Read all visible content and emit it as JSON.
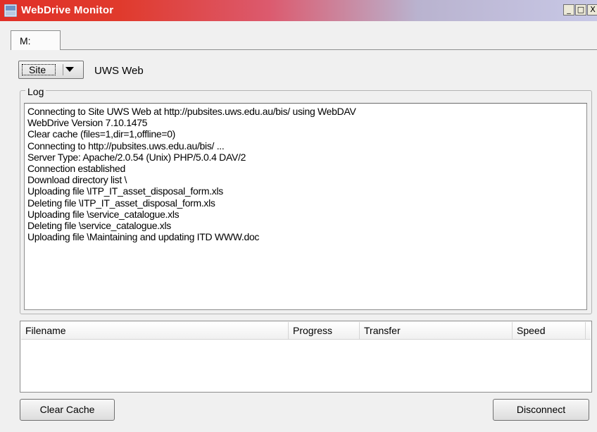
{
  "window": {
    "title": "WebDrive Monitor",
    "controls": {
      "minimize": "_",
      "maximize": "□",
      "close": "X"
    }
  },
  "tabs": [
    {
      "label": "M:",
      "selected": true
    }
  ],
  "site": {
    "button_label": "Site",
    "name": "UWS Web"
  },
  "log": {
    "legend": "Log",
    "lines": [
      "Connecting to Site UWS Web at http://pubsites.uws.edu.au/bis/ using WebDAV",
      "WebDrive Version 7.10.1475",
      "Clear cache (files=1,dir=1,offline=0)",
      "Connecting to http://pubsites.uws.edu.au/bis/ ...",
      "Server Type: Apache/2.0.54 (Unix) PHP/5.0.4 DAV/2",
      "Connection established",
      "Download directory list \\",
      "Uploading file \\ITP_IT_asset_disposal_form.xls",
      "Deleting file \\ITP_IT_asset_disposal_form.xls",
      "Uploading file \\service_catalogue.xls",
      "Deleting file \\service_catalogue.xls",
      "Uploading file \\Maintaining and updating ITD WWW.doc"
    ]
  },
  "transfers": {
    "columns": {
      "filename": "Filename",
      "progress": "Progress",
      "transfer": "Transfer",
      "speed": "Speed"
    },
    "rows": []
  },
  "buttons": {
    "clear_cache": "Clear Cache",
    "disconnect": "Disconnect"
  }
}
